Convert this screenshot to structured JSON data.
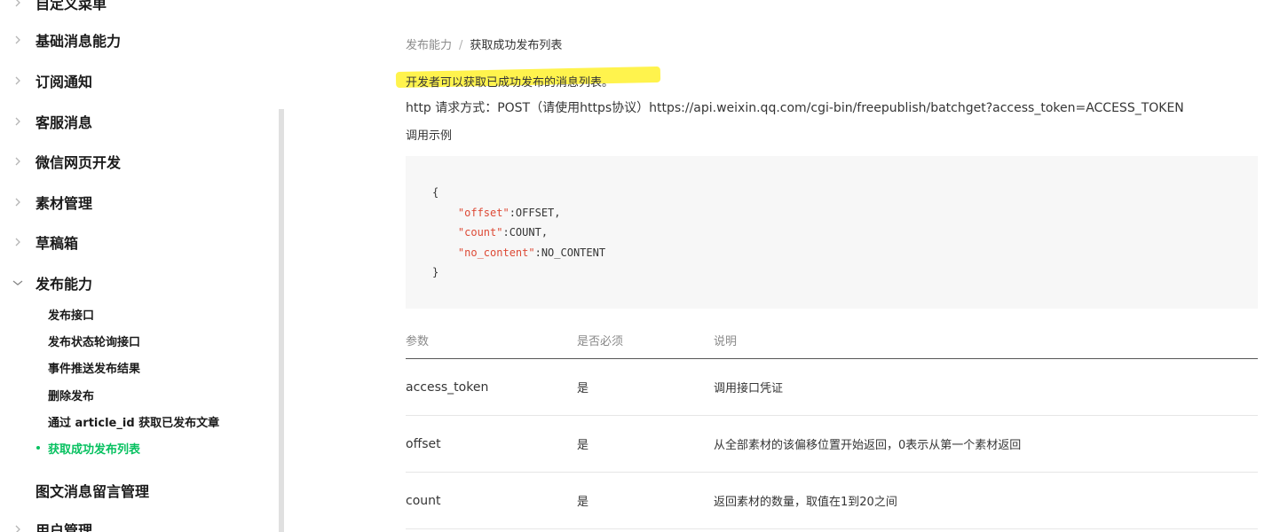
{
  "sidebar": {
    "items": [
      {
        "label": "自定义菜单",
        "expanded": false
      },
      {
        "label": "基础消息能力",
        "expanded": false
      },
      {
        "label": "订阅通知",
        "expanded": false
      },
      {
        "label": "客服消息",
        "expanded": false
      },
      {
        "label": "微信网页开发",
        "expanded": false
      },
      {
        "label": "素材管理",
        "expanded": false
      },
      {
        "label": "草稿箱",
        "expanded": false
      },
      {
        "label": "发布能力",
        "expanded": true
      }
    ],
    "sub_items": [
      {
        "label": "发布接口",
        "active": false
      },
      {
        "label": "发布状态轮询接口",
        "active": false
      },
      {
        "label": "事件推送发布结果",
        "active": false
      },
      {
        "label": "删除发布",
        "active": false
      },
      {
        "label": "通过 article_id 获取已发布文章",
        "active": false
      },
      {
        "label": "获取成功发布列表",
        "active": true
      }
    ],
    "after_items": [
      {
        "label": "图文消息留言管理",
        "expanded": false
      },
      {
        "label": "用户管理",
        "expanded": false
      }
    ]
  },
  "breadcrumb": {
    "parent": "发布能力",
    "separator": "/",
    "current": "获取成功发布列表"
  },
  "content": {
    "intro": "开发者可以获取已成功发布的消息列表。",
    "http_line": "http 请求方式：POST（请使用https协议）https://api.weixin.qq.com/cgi-bin/freepublish/batchget?access_token=ACCESS_TOKEN",
    "example_label": "调用示例",
    "code": {
      "open": "{",
      "fields": [
        {
          "key": "\"offset\"",
          "value": ":OFFSET,"
        },
        {
          "key": "\"count\"",
          "value": ":COUNT,"
        },
        {
          "key": "\"no_content\"",
          "value": ":NO_CONTENT"
        }
      ],
      "close": "}"
    },
    "table": {
      "headers": [
        "参数",
        "是否必须",
        "说明"
      ],
      "rows": [
        [
          "access_token",
          "是",
          "调用接口凭证"
        ],
        [
          "offset",
          "是",
          "从全部素材的该偏移位置开始返回，0表示从第一个素材返回"
        ],
        [
          "count",
          "是",
          "返回素材的数量，取值在1到20之间"
        ]
      ]
    }
  },
  "colors": {
    "accent": "#07c160",
    "code_key": "#dd4a36",
    "highlight": "#fff23a"
  }
}
